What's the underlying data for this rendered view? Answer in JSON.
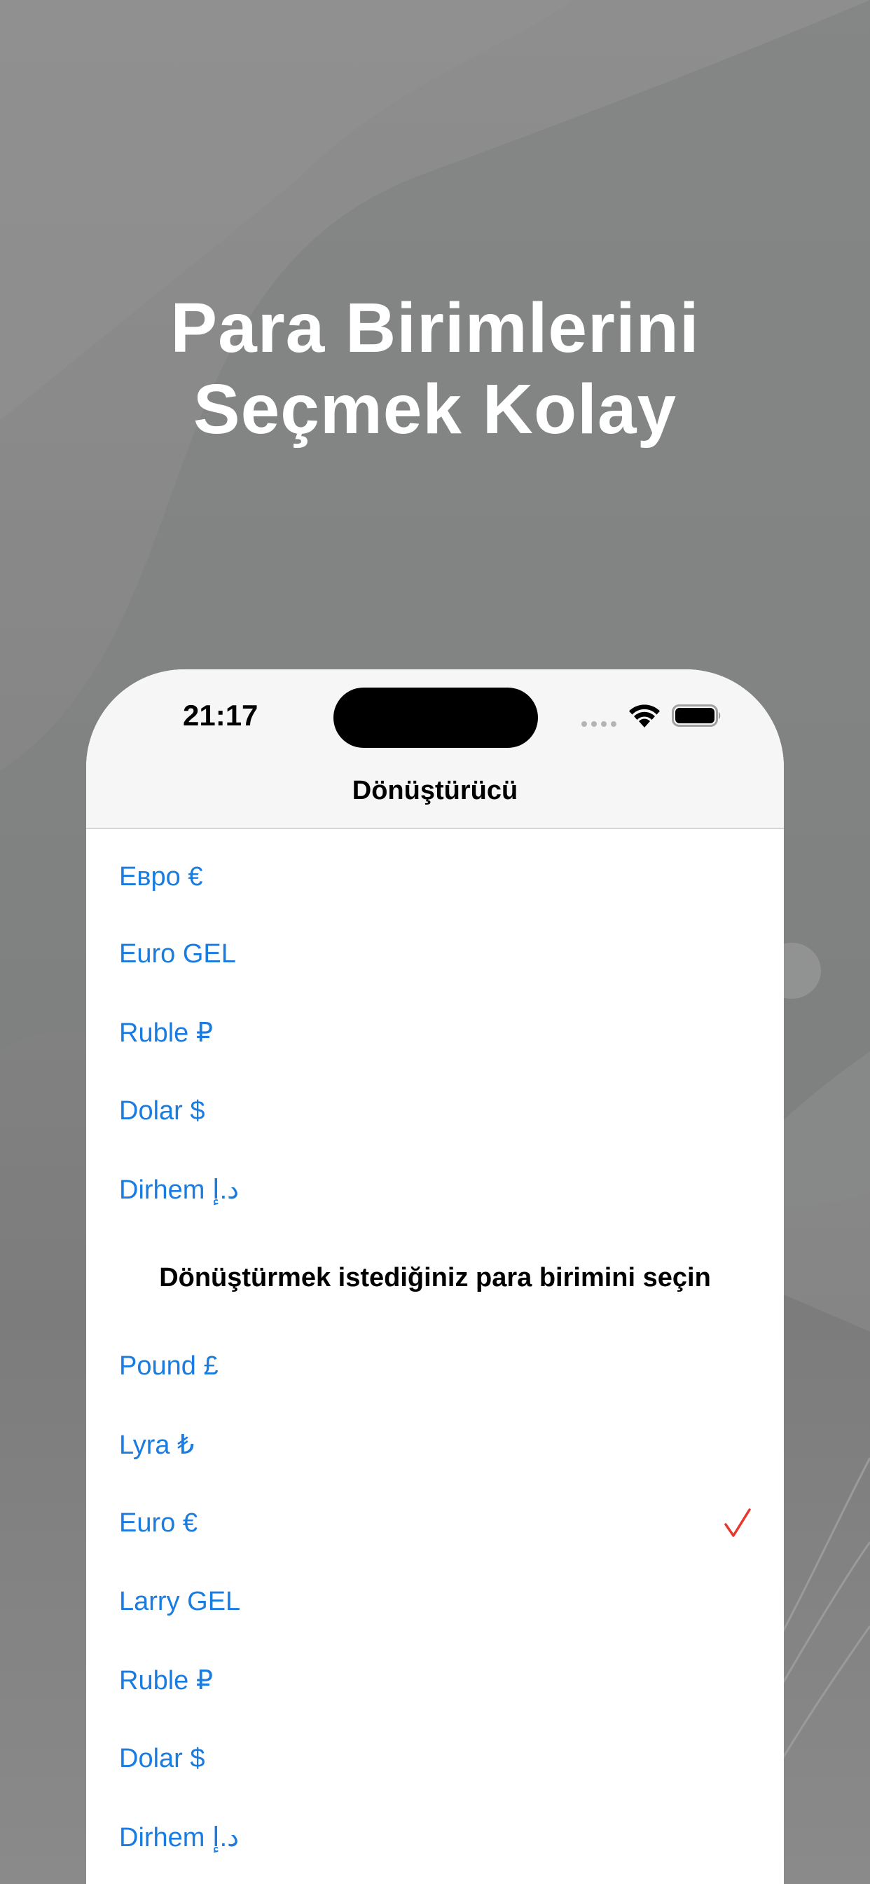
{
  "headline": {
    "line1": "Para Birimlerini",
    "line2": "Seçmek Kolay"
  },
  "status_bar": {
    "time": "21:17"
  },
  "nav": {
    "title": "Dönüştürücü"
  },
  "source_currencies": [
    {
      "label": "Евро €"
    },
    {
      "label": "Euro GEL"
    },
    {
      "label": "Ruble ₽"
    },
    {
      "label": "Dolar $"
    },
    {
      "label": "Dirhem د.إ"
    }
  ],
  "target_section": {
    "header": "Dönüştürmek istediğiniz para birimini seçin"
  },
  "target_currencies": [
    {
      "label": "Pound £",
      "selected": false
    },
    {
      "label": "Lyra ₺",
      "selected": false
    },
    {
      "label": "Euro €",
      "selected": true
    },
    {
      "label": "Larry GEL",
      "selected": false
    },
    {
      "label": "Ruble ₽",
      "selected": false
    },
    {
      "label": "Dolar $",
      "selected": false
    },
    {
      "label": "Dirhem د.إ",
      "selected": false
    }
  ],
  "colors": {
    "accent": "#1a7ce0",
    "checkmark": "#e5382f",
    "background": "#868686"
  }
}
